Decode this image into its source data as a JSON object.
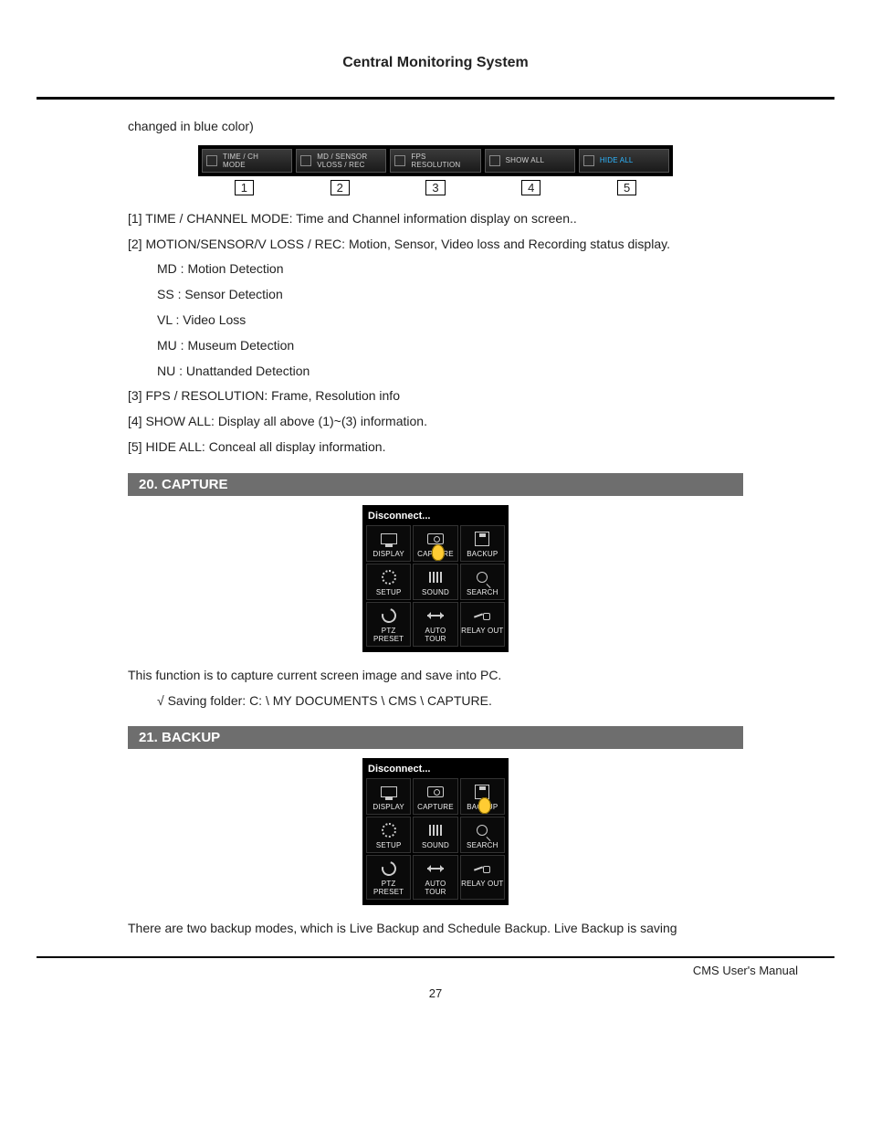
{
  "page_title": "Central Monitoring System",
  "intro_fragment": "changed in blue color)",
  "toolbar": {
    "items": [
      {
        "label": "TIME / CH\nMODE"
      },
      {
        "label": "MD / SENSOR\nVLOSS / REC"
      },
      {
        "label": "FPS\nRESOLUTION"
      },
      {
        "label": "SHOW ALL"
      },
      {
        "label": "HIDE ALL",
        "highlight": true
      }
    ],
    "numbers": [
      "1",
      "2",
      "3",
      "4",
      "5"
    ]
  },
  "definitions": [
    "[1] TIME / CHANNEL MODE: Time and Channel information display on screen..",
    "[2] MOTION/SENSOR/V LOSS / REC: Motion, Sensor, Video loss and Recording status display."
  ],
  "sub_defs": [
    "MD : Motion Detection",
    "SS : Sensor Detection",
    "VL : Video Loss",
    "MU : Museum Detection",
    "NU : Unattanded Detection"
  ],
  "definitions_tail": [
    "[3] FPS / RESOLUTION: Frame, Resolution info",
    "[4] SHOW ALL: Display all above (1)~(3) information.",
    "[5] HIDE ALL: Conceal all display information."
  ],
  "section_capture": {
    "heading": "20. CAPTURE",
    "panel_title": "Disconnect...",
    "cells": [
      "DISPLAY",
      "CAPTURE",
      "BACKUP",
      "SETUP",
      "SOUND",
      "SEARCH",
      "PTZ PRESET",
      "AUTO TOUR",
      "RELAY OUT"
    ],
    "cursor_on": 1,
    "body": "This function is to capture current screen image and save into PC.",
    "note": "Saving folder: C: \\ MY DOCUMENTS \\ CMS \\ CAPTURE."
  },
  "section_backup": {
    "heading": "21. BACKUP",
    "panel_title": "Disconnect...",
    "cells": [
      "DISPLAY",
      "CAPTURE",
      "BACKUP",
      "SETUP",
      "SOUND",
      "SEARCH",
      "PTZ PRESET",
      "AUTO TOUR",
      "RELAY OUT"
    ],
    "cursor_on": 2,
    "body": "There are two backup modes, which is Live Backup and Schedule Backup. Live Backup is saving"
  },
  "footer": "CMS User's Manual",
  "page_number": "27",
  "check_symbol": "√"
}
